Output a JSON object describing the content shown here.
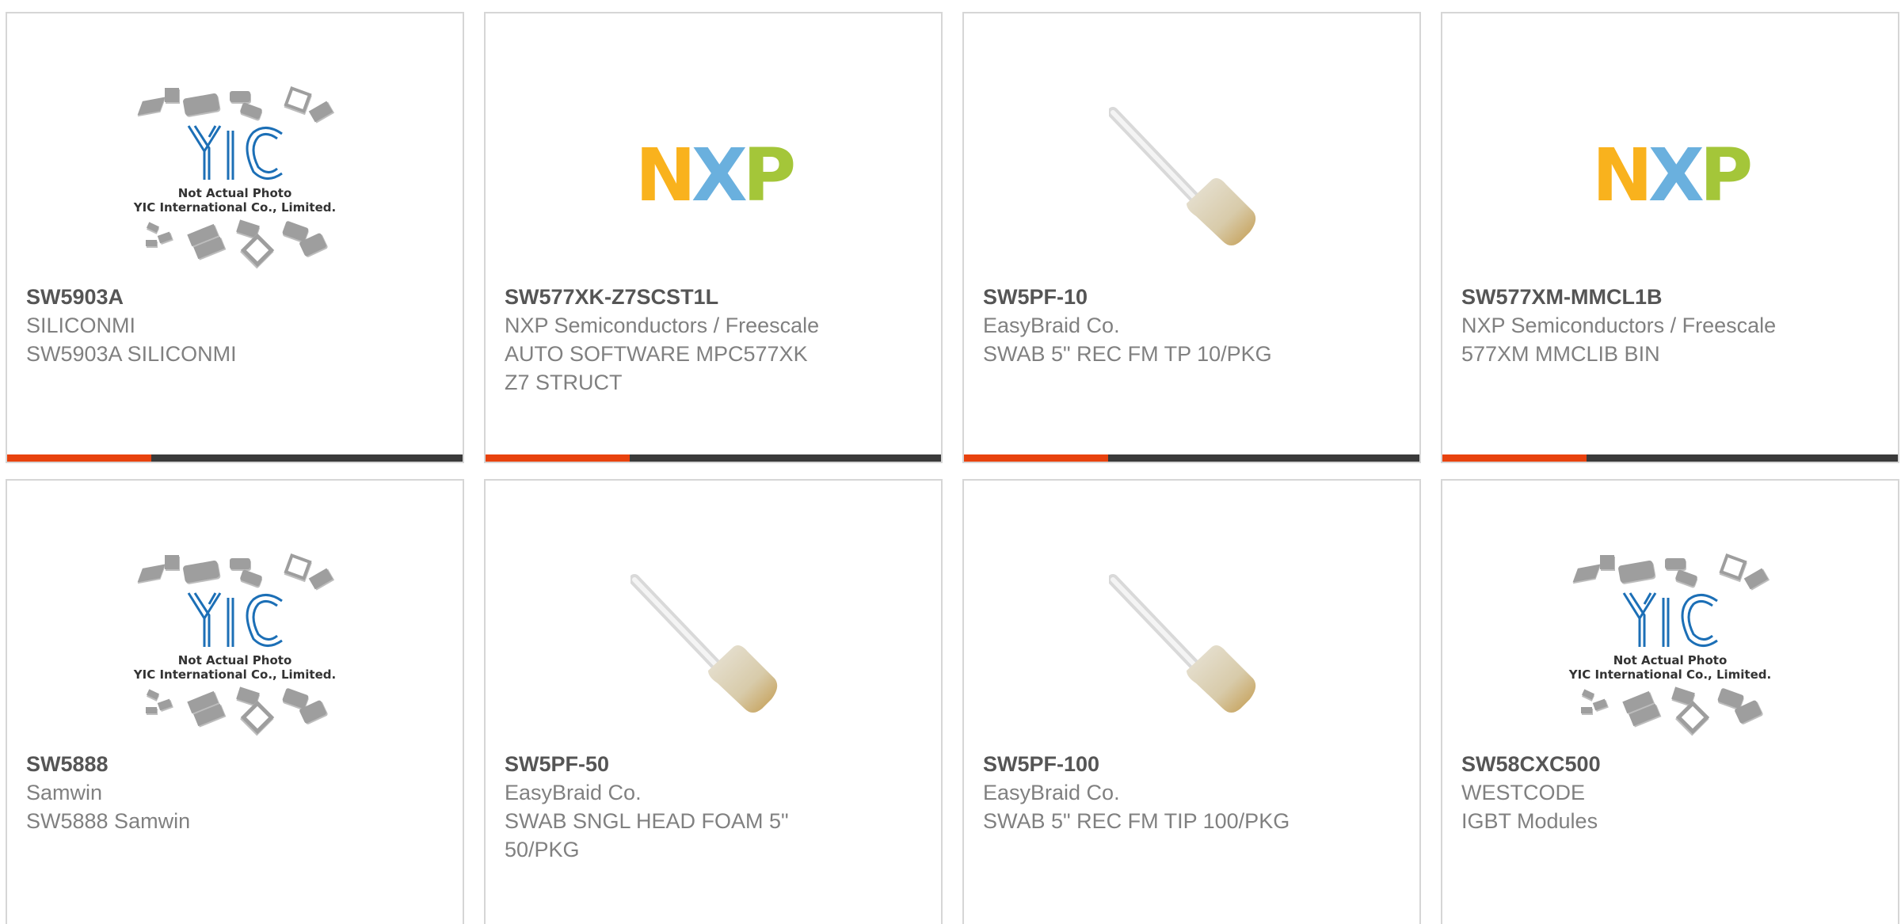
{
  "placeholder_image": {
    "caption": "Not Actual Photo\nYIC International Co., Limited.",
    "logo_text": "YIC"
  },
  "nxp_logo": {
    "letters": [
      "N",
      "X",
      "P"
    ],
    "colors": [
      "#f9b21d",
      "#6ab0de",
      "#a4c639"
    ]
  },
  "accent_color": "#e8420e",
  "bar_color": "#3a3a3a",
  "products": [
    {
      "part": "SW5903A",
      "manufacturer": "SILICONMI",
      "description": "SW5903A SILICONMI",
      "image": "yic-placeholder"
    },
    {
      "part": "SW577XK-Z7SCST1L",
      "manufacturer": "NXP Semiconductors / Freescale",
      "description": "AUTO SOFTWARE MPC577XK\nZ7 STRUCT",
      "image": "nxp-logo"
    },
    {
      "part": "SW5PF-10",
      "manufacturer": "EasyBraid Co.",
      "description": "SWAB 5\" REC FM TP 10/PKG",
      "image": "foam-swab"
    },
    {
      "part": "SW577XM-MMCL1B",
      "manufacturer": "NXP Semiconductors / Freescale",
      "description": "577XM MMCLIB BIN",
      "image": "nxp-logo"
    },
    {
      "part": "SW5888",
      "manufacturer": "Samwin",
      "description": "SW5888 Samwin",
      "image": "yic-placeholder"
    },
    {
      "part": "SW5PF-50",
      "manufacturer": "EasyBraid Co.",
      "description": "SWAB SNGL HEAD FOAM 5\"\n50/PKG",
      "image": "foam-swab"
    },
    {
      "part": "SW5PF-100",
      "manufacturer": "EasyBraid Co.",
      "description": "SWAB 5\" REC FM TIP 100/PKG",
      "image": "foam-swab"
    },
    {
      "part": "SW58CXC500",
      "manufacturer": "WESTCODE",
      "description": "IGBT Modules",
      "image": "yic-placeholder"
    }
  ]
}
